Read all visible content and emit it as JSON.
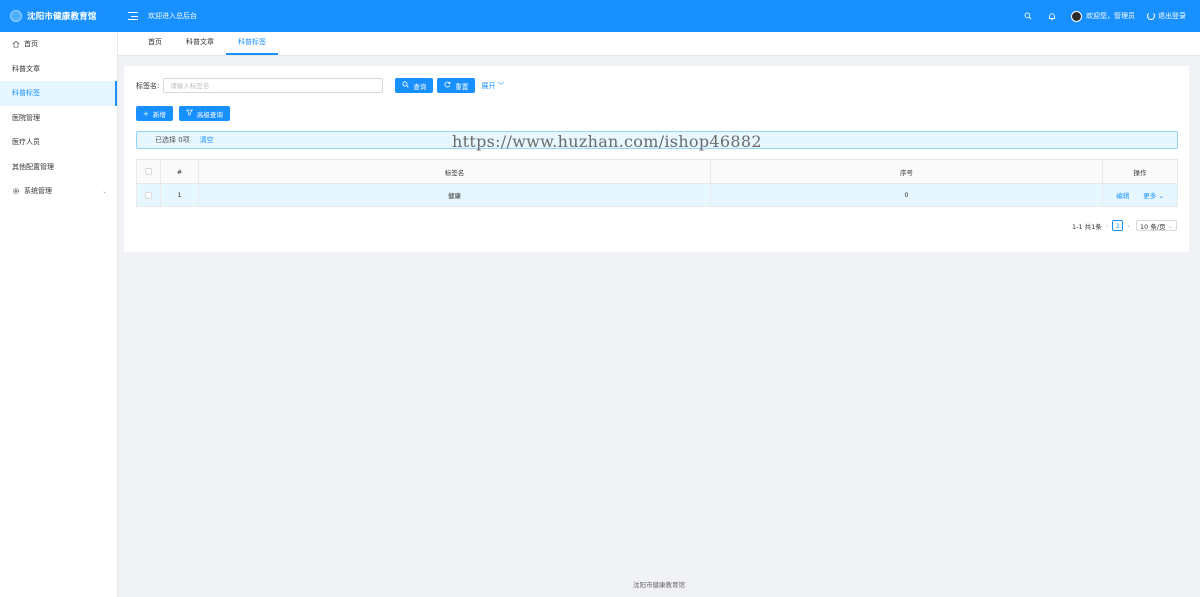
{
  "header": {
    "logo_text": "沈阳市健康教育馆",
    "welcome": "欢迎进入总后台",
    "user_text": "欢迎您，管理员",
    "logout_label": "退出登录"
  },
  "sidebar": {
    "items": [
      {
        "label": "首页"
      },
      {
        "label": "科普文章"
      },
      {
        "label": "科普标签"
      },
      {
        "label": "医院管理"
      },
      {
        "label": "医疗人员"
      },
      {
        "label": "其他配置管理"
      },
      {
        "label": "系统管理"
      }
    ]
  },
  "tabs": [
    {
      "label": "首页"
    },
    {
      "label": "科普文章"
    },
    {
      "label": "科普标签"
    }
  ],
  "search": {
    "label": "标签名:",
    "placeholder": "请输入标签名",
    "query_label": "查询",
    "reset_label": "重置",
    "expand_label": "展开"
  },
  "actions": {
    "add_label": "新增",
    "advanced_label": "高级查询"
  },
  "selection": {
    "text": "已选择 0项",
    "clear_label": "清空"
  },
  "watermark": "https://www.huzhan.com/ishop46882",
  "table": {
    "columns": [
      "#",
      "标签名",
      "序号",
      "操作"
    ],
    "rows": [
      {
        "index": "1",
        "name": "健康",
        "order": "0",
        "edit": "编辑",
        "more": "更多"
      }
    ]
  },
  "pagination": {
    "summary": "1-1 共1条",
    "current": "1",
    "page_size": "10 条/页"
  },
  "footer": "沈阳市健康教育馆",
  "colors": {
    "primary": "#1890ff",
    "active_bg": "#e6f7ff"
  }
}
